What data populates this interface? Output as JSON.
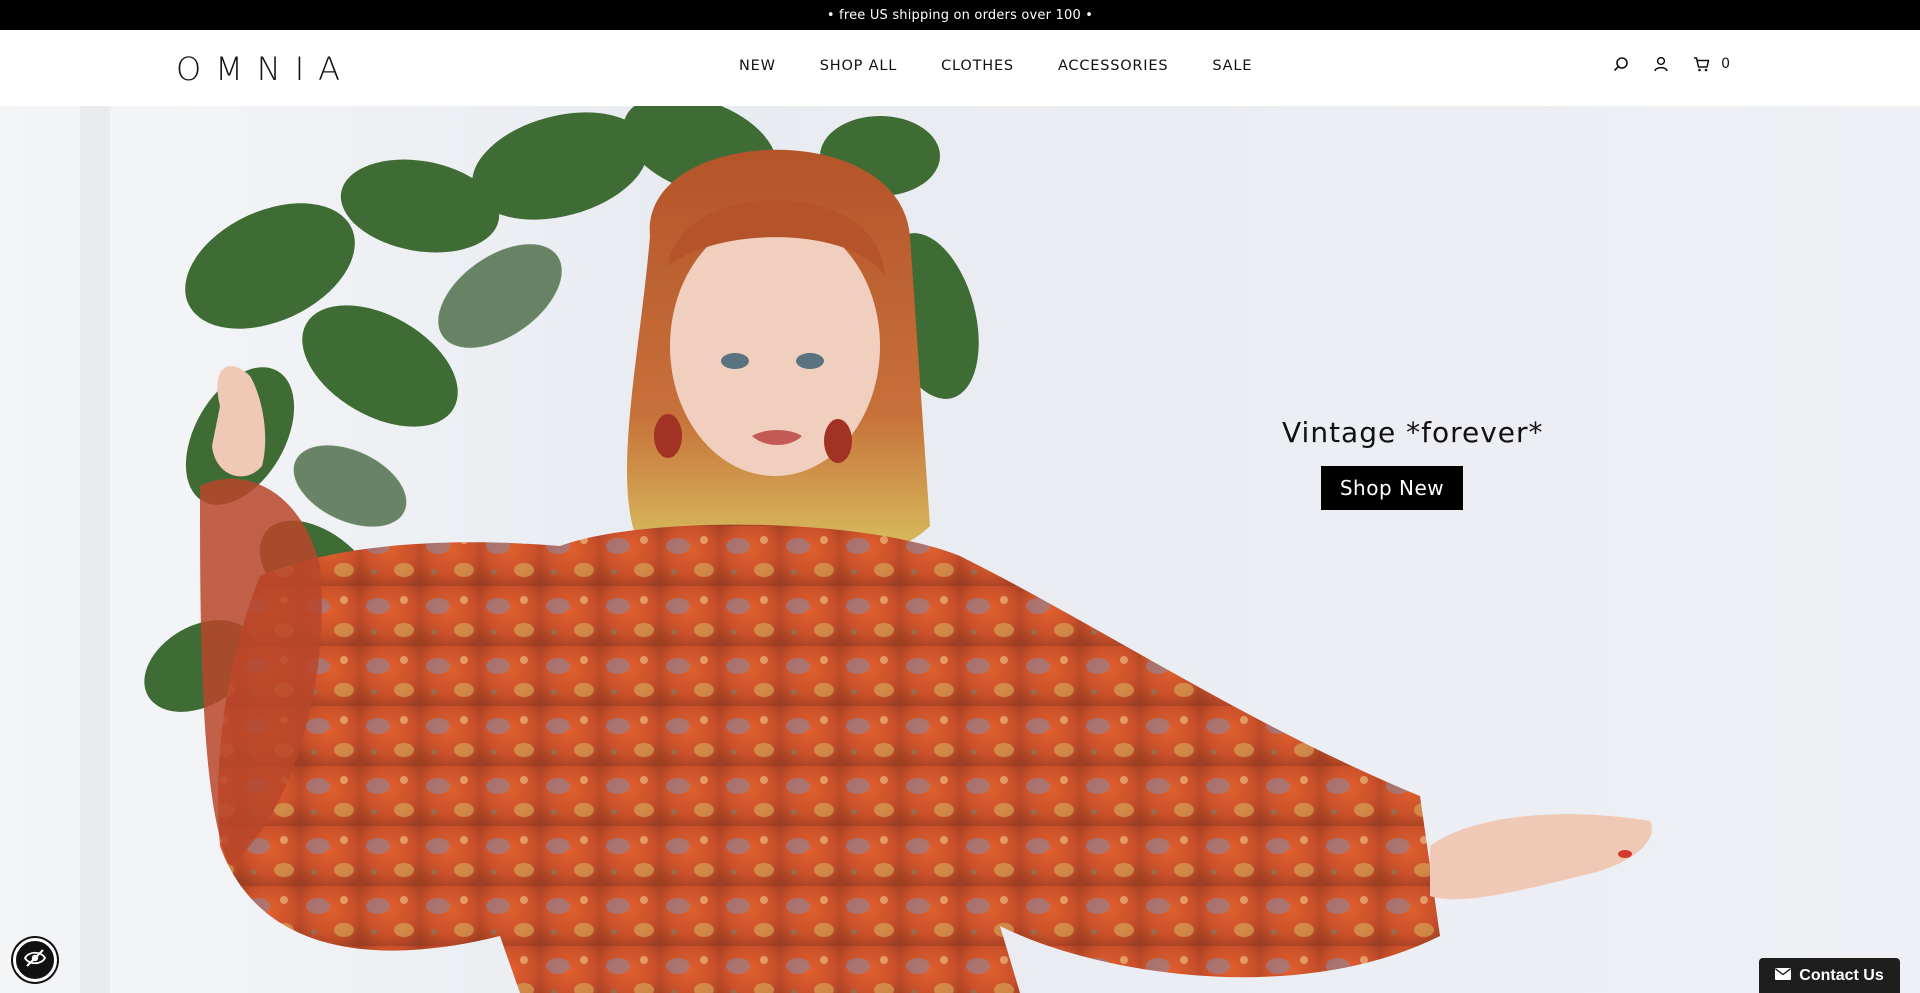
{
  "announcement": {
    "text": "• free US shipping on orders over 100 •"
  },
  "header": {
    "logo": "OMNIA",
    "nav": [
      {
        "label": "NEW"
      },
      {
        "label": "SHOP ALL"
      },
      {
        "label": "CLOTHES"
      },
      {
        "label": "ACCESSORIES"
      },
      {
        "label": "SALE"
      }
    ],
    "icons": {
      "search": "search-icon",
      "account": "user-icon",
      "cart": "cart-icon"
    },
    "cart_count": "0"
  },
  "hero": {
    "heading": "Vintage *forever*",
    "button_label": "Shop New"
  },
  "widgets": {
    "accessibility_icon": "accessibility-eye-icon",
    "contact_label": "Contact Us",
    "contact_icon": "envelope-icon"
  },
  "colors": {
    "announcement_bg": "#000000",
    "button_bg": "#000000",
    "contact_bg": "#1e1e1e"
  }
}
